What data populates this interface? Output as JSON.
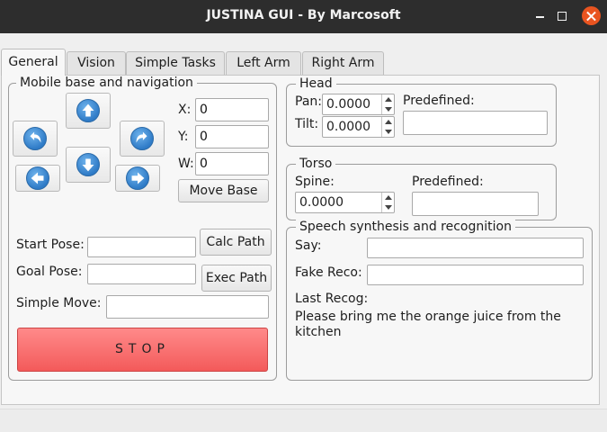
{
  "window": {
    "title": "JUSTINA GUI - By Marcosoft"
  },
  "tabs": [
    {
      "label": "General",
      "active": true
    },
    {
      "label": "Vision",
      "active": false
    },
    {
      "label": "Simple Tasks",
      "active": false
    },
    {
      "label": "Left Arm",
      "active": false
    },
    {
      "label": "Right Arm",
      "active": false
    }
  ],
  "mobile_base": {
    "title": "Mobile base and navigation",
    "x_label": "X:",
    "x_value": "0",
    "y_label": "Y:",
    "y_value": "0",
    "w_label": "W:",
    "w_value": "0",
    "move_base_label": "Move Base",
    "start_pose_label": "Start Pose:",
    "start_pose_value": "",
    "goal_pose_label": "Goal Pose:",
    "goal_pose_value": "",
    "calc_path_label": "Calc Path",
    "exec_path_label": "Exec Path",
    "simple_move_label": "Simple Move:",
    "simple_move_value": "",
    "stop_label": "STOP",
    "nav_icons": [
      "arrow-up-icon",
      "turn-left-icon",
      "turn-right-icon",
      "arrow-down-icon",
      "arrow-left-icon",
      "arrow-right-icon"
    ]
  },
  "head": {
    "title": "Head",
    "pan_label": "Pan:",
    "pan_value": "0.0000",
    "tilt_label": "Tilt:",
    "tilt_value": "0.0000",
    "predefined_label": "Predefined:",
    "predefined_value": ""
  },
  "torso": {
    "title": "Torso",
    "spine_label": "Spine:",
    "spine_value": "0.0000",
    "predefined_label": "Predefined:",
    "predefined_value": ""
  },
  "speech": {
    "title": "Speech synthesis and recognition",
    "say_label": "Say:",
    "say_value": "",
    "fake_reco_label": "Fake Reco:",
    "fake_reco_value": "",
    "last_recog_label": "Last Recog:",
    "last_recog_value": "Please bring me the orange juice from the kitchen"
  },
  "colors": {
    "titlebar": "#2d2d2d",
    "close": "#e95420",
    "stop": "#f35a5a",
    "nav_icon": "#2f7bc7"
  }
}
